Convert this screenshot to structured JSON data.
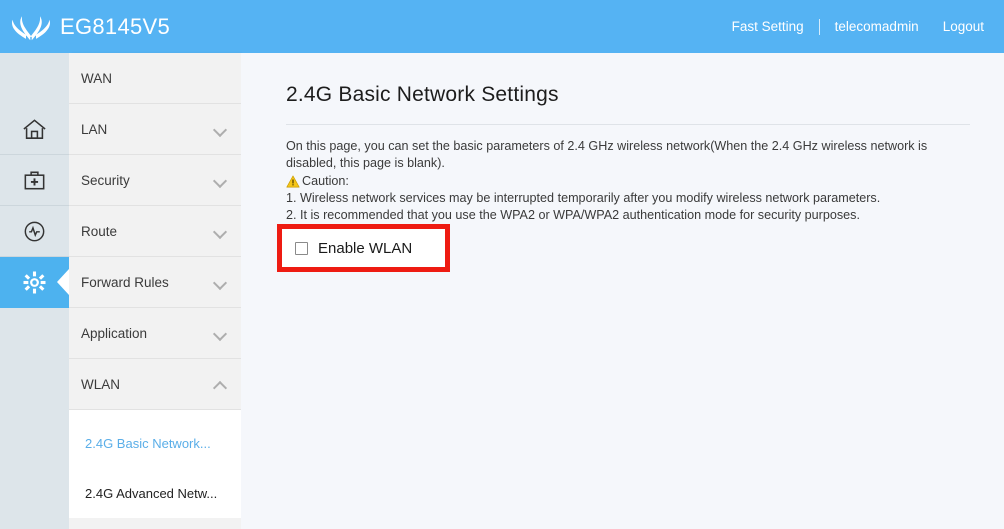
{
  "header": {
    "brand_name": "EG8145V5",
    "logo_icon": "huawei-flower-logo",
    "fast_setting": "Fast Setting",
    "username": "telecomadmin",
    "logout": "Logout"
  },
  "rail": {
    "items": [
      {
        "icon": "home-icon",
        "active": false
      },
      {
        "icon": "medical-kit-icon",
        "active": false
      },
      {
        "icon": "diagnostics-icon",
        "active": false
      },
      {
        "icon": "gear-icon",
        "active": true
      }
    ]
  },
  "sidebar": {
    "items": [
      {
        "label": "WAN",
        "chevron": "none"
      },
      {
        "label": "LAN",
        "chevron": "down"
      },
      {
        "label": "Security",
        "chevron": "down"
      },
      {
        "label": "Route",
        "chevron": "down"
      },
      {
        "label": "Forward Rules",
        "chevron": "down"
      },
      {
        "label": "Application",
        "chevron": "down"
      },
      {
        "label": "WLAN",
        "chevron": "up"
      }
    ],
    "submenu": [
      {
        "label": "2.4G Basic Network...",
        "active": true
      },
      {
        "label": "2.4G Advanced Netw...",
        "active": false
      }
    ]
  },
  "main": {
    "title": "2.4G Basic Network Settings",
    "description_line1": "On this page, you can set the basic parameters of 2.4 GHz wireless network(When the 2.4 GHz wireless network is",
    "description_line2": "disabled, this page is blank).",
    "caution_label": "Caution:",
    "caution_icon": "warning-triangle-icon",
    "note1": "1. Wireless network services may be interrupted temporarily after you modify wireless network parameters.",
    "note2": "2. It is recommended that you use the WPA2 or WPA/WPA2 authentication mode for security purposes.",
    "enable_wlan_label": "Enable WLAN",
    "enable_wlan_checked": false
  },
  "colors": {
    "header_blue": "#55b3f3",
    "accent_blue": "#4db2ef",
    "active_link_blue": "#5aaee8",
    "highlight_red": "#ee1b12",
    "rail_bg": "#dde5ea",
    "menu_bg": "#f2f2f2",
    "content_bg": "#f5f7fb",
    "warning_yellow": "#f5c518"
  }
}
